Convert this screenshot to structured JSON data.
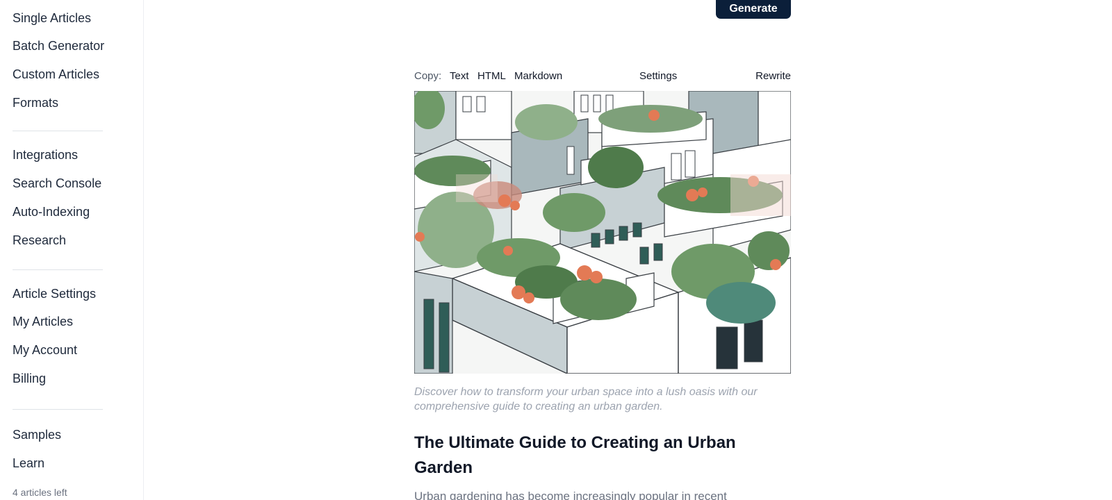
{
  "sidebar": {
    "groups": [
      [
        "Single Articles",
        "Batch Generator",
        "Custom Articles",
        "Formats"
      ],
      [
        "Integrations",
        "Search Console",
        "Auto-Indexing",
        "Research"
      ],
      [
        "Article Settings",
        "My Articles",
        "My Account",
        "Billing"
      ],
      [
        "Samples",
        "Learn"
      ]
    ],
    "articles_left": "4 articles left"
  },
  "toolbar": {
    "generate_label": "Generate"
  },
  "copybar": {
    "copy_label": "Copy:",
    "options": [
      "Text",
      "HTML",
      "Markdown"
    ],
    "settings_label": "Settings",
    "rewrite_label": "Rewrite"
  },
  "article": {
    "caption": "Discover how to transform your urban space into a lush oasis with our comprehensive guide to creating an urban garden.",
    "title": "The Ultimate Guide to Creating an Urban Garden",
    "body_start": "Urban gardening has become increasingly popular in recent"
  },
  "colors": {
    "primary_button": "#0b1f3a",
    "plant_green": "#5f8a5a",
    "flower_orange": "#e37a55",
    "building_gray": "#a9b8bc",
    "window_teal": "#2f5d57"
  }
}
